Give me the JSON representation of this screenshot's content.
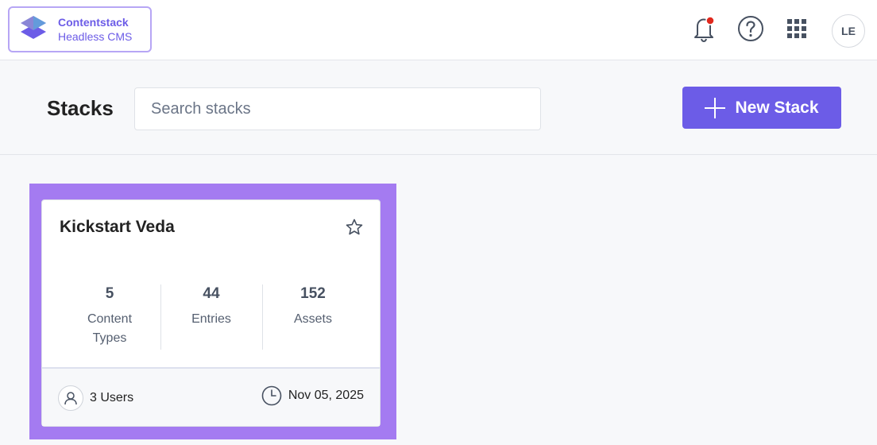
{
  "brand": {
    "name": "Contentstack",
    "subtitle": "Headless CMS"
  },
  "topbar": {
    "notifications_icon": "bell-icon",
    "help_icon": "help-icon",
    "apps_icon": "grid-icon",
    "avatar_initials": "LE",
    "notification_dot_color": "#e0281d"
  },
  "header": {
    "title": "Stacks",
    "search_placeholder": "Search stacks",
    "new_button_label": "New Stack"
  },
  "colors": {
    "accent": "#6c5ce7",
    "highlight": "#a47bf1"
  },
  "stack_card": {
    "name": "Kickstart Veda",
    "starred": false,
    "stats": [
      {
        "value": "5",
        "label": "Content Types"
      },
      {
        "value": "44",
        "label": "Entries"
      },
      {
        "value": "152",
        "label": "Assets"
      }
    ],
    "users": "3 Users",
    "date": "Nov 05, 2025"
  }
}
